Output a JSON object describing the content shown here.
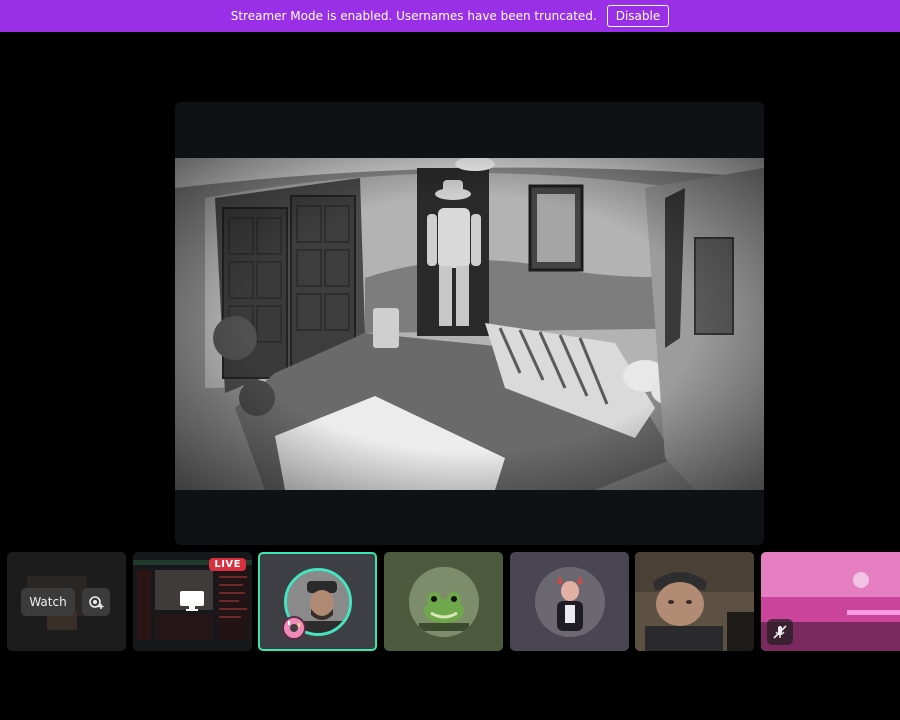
{
  "banner": {
    "message": "Streamer Mode is enabled. Usernames have been truncated.",
    "disable_label": "Disable",
    "background": "#9a2fe8"
  },
  "strip": {
    "tiles": [
      {
        "kind": "self-preview",
        "watch_label": "Watch"
      },
      {
        "kind": "screenshare",
        "badge": "LIVE"
      },
      {
        "kind": "avatar",
        "selected": true,
        "accent": "#3ce6b0"
      },
      {
        "kind": "avatar"
      },
      {
        "kind": "avatar"
      },
      {
        "kind": "camera"
      },
      {
        "kind": "camera",
        "muted": true
      }
    ]
  }
}
